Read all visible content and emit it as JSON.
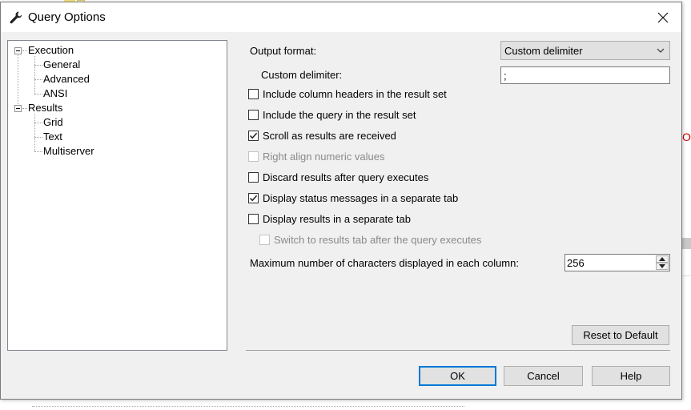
{
  "window": {
    "title": "Query Options",
    "icon": "wrench-icon"
  },
  "tree": {
    "items": [
      {
        "label": "Execution",
        "expanded": true,
        "children": [
          "General",
          "Advanced",
          "ANSI"
        ]
      },
      {
        "label": "Results",
        "expanded": true,
        "children": [
          "Grid",
          "Text",
          "Multiserver"
        ]
      }
    ],
    "selected": "Text"
  },
  "form": {
    "output_format_label": "Output format:",
    "output_format_value": "Custom delimiter",
    "custom_delimiter_label": "Custom delimiter:",
    "custom_delimiter_value": ";",
    "checkboxes": [
      {
        "label": "Include column headers in the result set",
        "checked": false,
        "enabled": true
      },
      {
        "label": "Include the query in the result set",
        "checked": false,
        "enabled": true
      },
      {
        "label": "Scroll as results are received",
        "checked": true,
        "enabled": true
      },
      {
        "label": "Right align numeric values",
        "checked": false,
        "enabled": false
      },
      {
        "label": "Discard results after query executes",
        "checked": false,
        "enabled": true
      },
      {
        "label": "Display status messages in a separate tab",
        "checked": true,
        "enabled": true
      },
      {
        "label": "Display results in a separate tab",
        "checked": false,
        "enabled": true
      },
      {
        "label": "Switch to results tab after the query executes",
        "checked": false,
        "enabled": false
      }
    ],
    "max_chars_label": "Maximum number of characters displayed in each column:",
    "max_chars_value": "256"
  },
  "buttons": {
    "reset": "Reset to Default",
    "ok": "OK",
    "cancel": "Cancel",
    "help": "Help"
  },
  "background": {
    "edge_text": "OM"
  },
  "colors": {
    "dialog_bg": "#f0f0f0",
    "primary_border": "#0078d7",
    "disabled_text": "#8a8a8a"
  }
}
